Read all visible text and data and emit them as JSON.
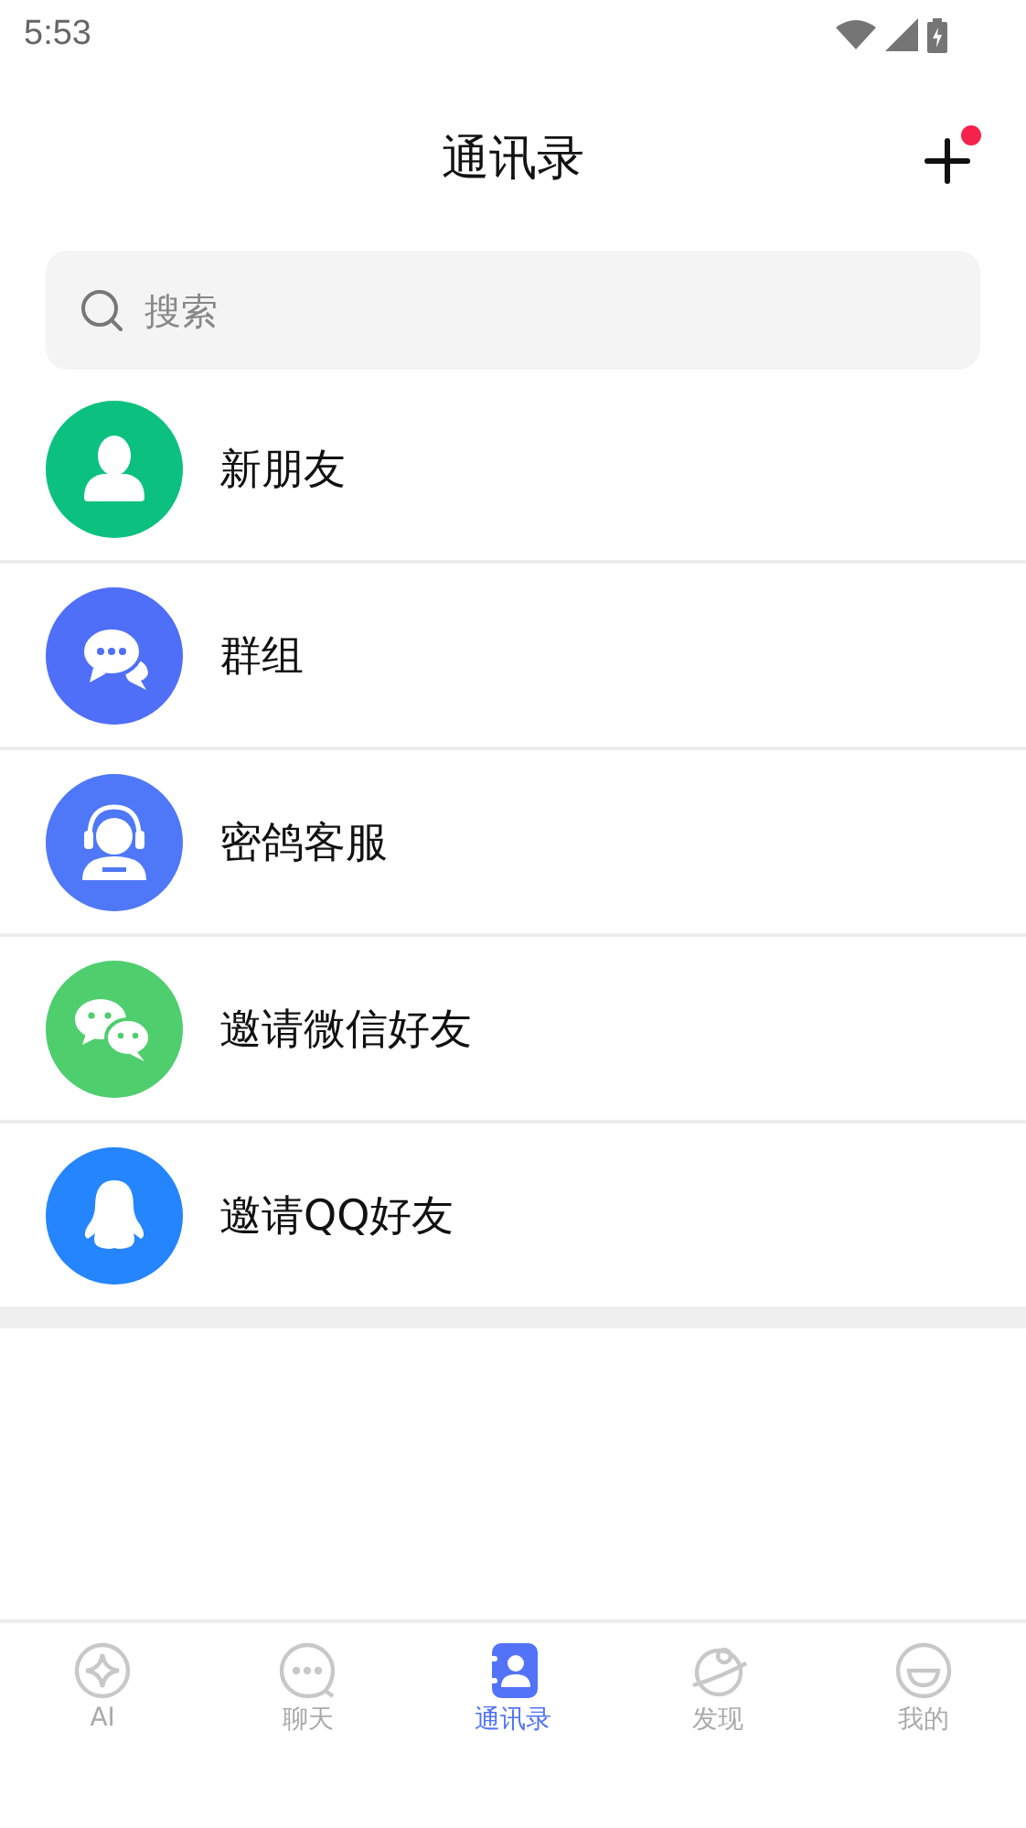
{
  "status_bar": {
    "time": "5:53"
  },
  "header": {
    "title": "通讯录",
    "add_badge": true
  },
  "search": {
    "placeholder": "搜索"
  },
  "entries": [
    {
      "label": "新朋友",
      "kind": "person",
      "color": "#0cc17f"
    },
    {
      "label": "群组",
      "kind": "chat",
      "color": "#4f6ff8"
    },
    {
      "label": "密鸽客服",
      "kind": "support",
      "color": "#4f78f8"
    },
    {
      "label": "邀请微信好友",
      "kind": "wechat",
      "color": "#4fce6e"
    },
    {
      "label": "邀请QQ好友",
      "kind": "penguin",
      "color": "#2585ff"
    }
  ],
  "tabs": [
    {
      "label": "AI",
      "kind": "ai",
      "selected": false
    },
    {
      "label": "聊天",
      "kind": "chat",
      "selected": false
    },
    {
      "label": "通讯录",
      "kind": "contacts",
      "selected": true
    },
    {
      "label": "发现",
      "kind": "planet",
      "selected": false
    },
    {
      "label": "我的",
      "kind": "smile",
      "selected": false
    }
  ]
}
